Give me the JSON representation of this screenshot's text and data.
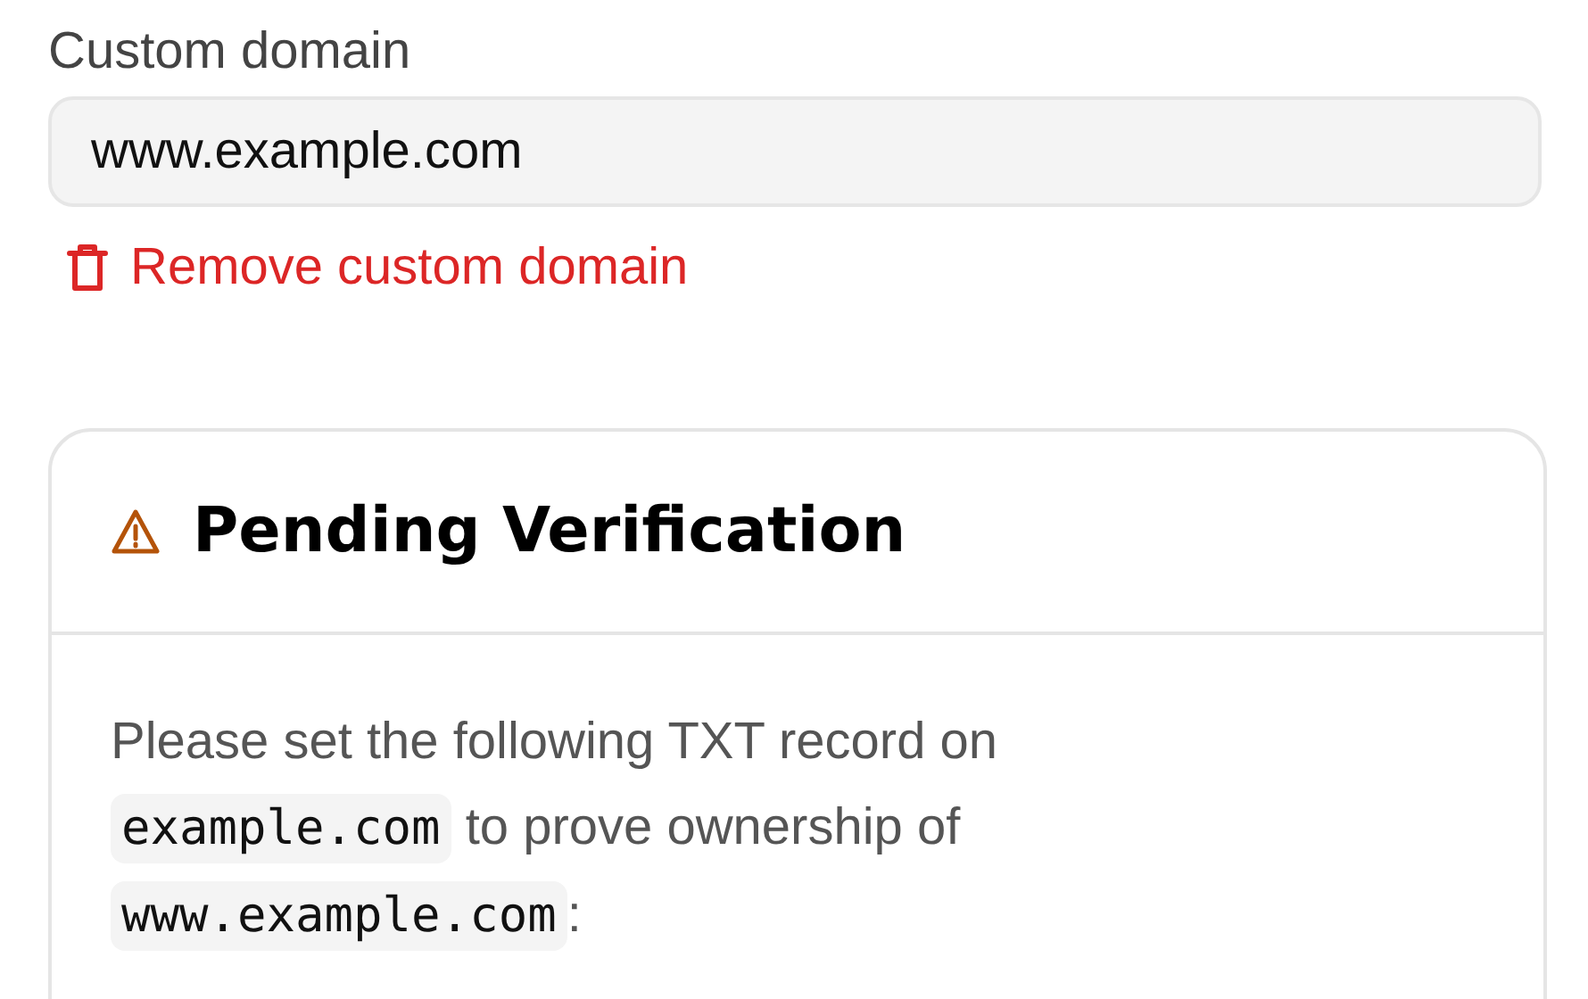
{
  "custom_domain": {
    "label": "Custom domain",
    "value": "www.example.com",
    "remove_link": "Remove custom domain"
  },
  "verification": {
    "title": "Pending Verification",
    "instructions": [
      {
        "kind": "text",
        "text": "Please set the following TXT record on "
      },
      {
        "kind": "code",
        "text": "example.com"
      },
      {
        "kind": "text",
        "text": " to prove ownership of "
      },
      {
        "kind": "code",
        "text": "www.example.com"
      },
      {
        "kind": "text",
        "text": ":"
      }
    ]
  }
}
